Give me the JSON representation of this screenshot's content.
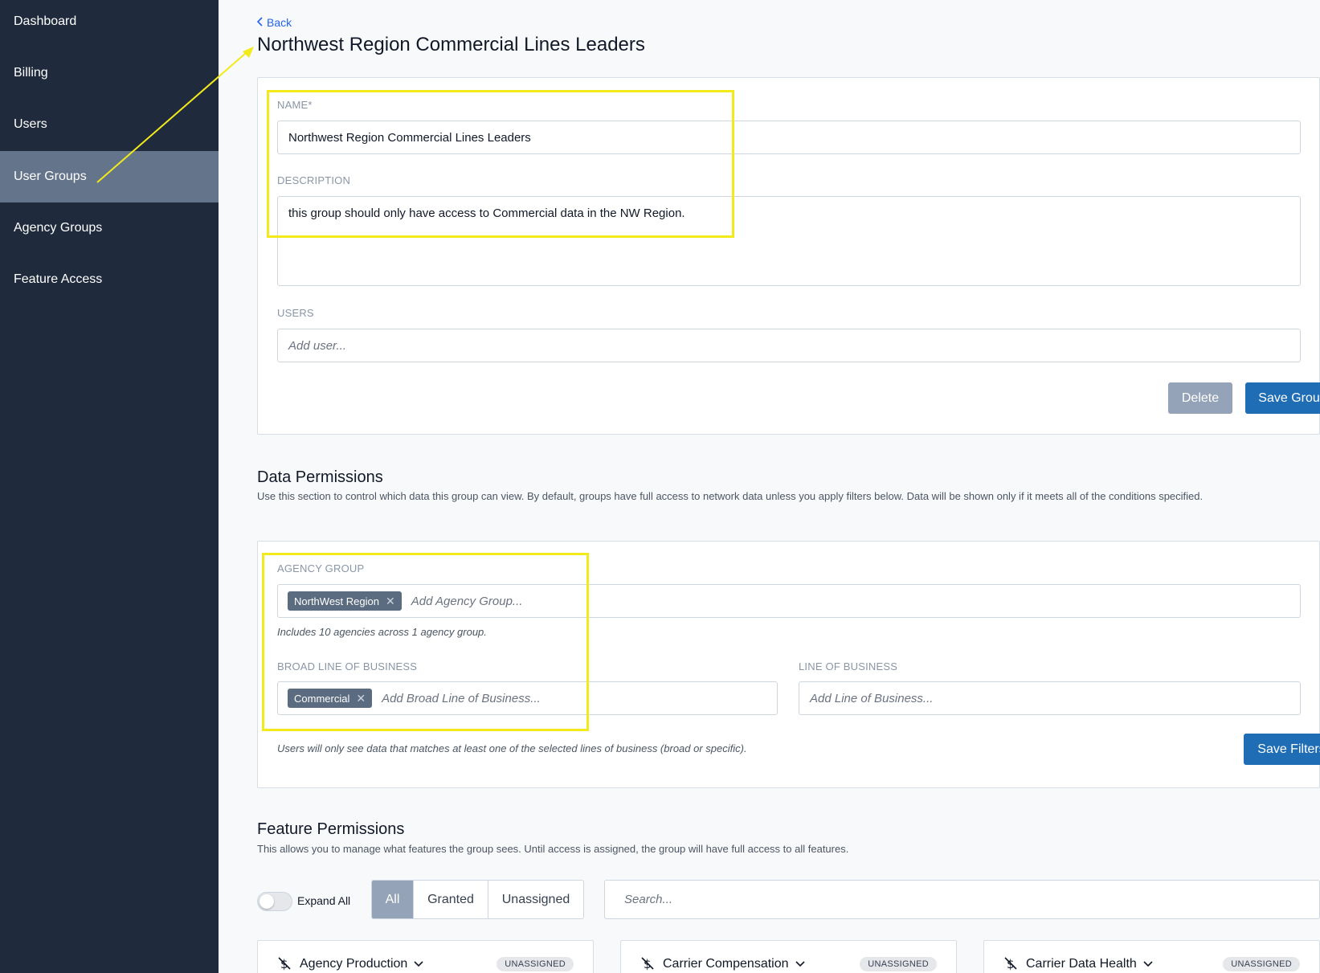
{
  "sidebar": {
    "items": [
      {
        "label": "Dashboard"
      },
      {
        "label": "Billing"
      },
      {
        "label": "Users"
      },
      {
        "label": "User Groups",
        "active": true
      },
      {
        "label": "Agency Groups"
      },
      {
        "label": "Feature Access"
      }
    ]
  },
  "header": {
    "back_label": "Back",
    "title": "Northwest Region Commercial Lines Leaders"
  },
  "group_form": {
    "name_label": "NAME*",
    "name_value": "Northwest Region Commercial Lines Leaders",
    "description_label": "DESCRIPTION",
    "description_value": "this group should only have access to Commercial data in the NW Region.",
    "users_label": "USERS",
    "users_placeholder": "Add user...",
    "delete_label": "Delete",
    "save_label": "Save Group"
  },
  "data_permissions": {
    "title": "Data Permissions",
    "description": "Use this section to control which data this group can view. By default, groups have full access to network data unless you apply filters below. Data will be shown only if it meets all of the conditions specified.",
    "agency_group_label": "AGENCY GROUP",
    "agency_group_chip": "NorthWest Region",
    "agency_group_placeholder": "Add Agency Group...",
    "agency_group_note": "Includes 10 agencies across 1 agency group.",
    "broad_lob_label": "BROAD LINE OF BUSINESS",
    "broad_lob_chip": "Commercial",
    "broad_lob_placeholder": "Add Broad Line of Business...",
    "lob_label": "LINE OF BUSINESS",
    "lob_placeholder": "Add Line of Business...",
    "lob_note": "Users will only see data that matches at least one of the selected lines of business (broad or specific).",
    "save_filters_label": "Save Filters"
  },
  "feature_permissions": {
    "title": "Feature Permissions",
    "description": "This allows you to manage what features the group sees. Until access is assigned, the group will have full access to all features.",
    "expand_all_label": "Expand All",
    "expand_all_on": false,
    "filters": [
      "All",
      "Granted",
      "Unassigned"
    ],
    "active_filter": "All",
    "search_placeholder": "Search...",
    "cards": [
      {
        "name": "Agency Production",
        "status": "UNASSIGNED"
      },
      {
        "name": "Carrier Compensation",
        "status": "UNASSIGNED"
      },
      {
        "name": "Carrier Data Health",
        "status": "UNASSIGNED"
      }
    ]
  },
  "colors": {
    "sidebar_bg": "#1f2a3d",
    "sidebar_active": "#64748b",
    "primary": "#1f6db5",
    "annotation": "#f2ea1a"
  }
}
